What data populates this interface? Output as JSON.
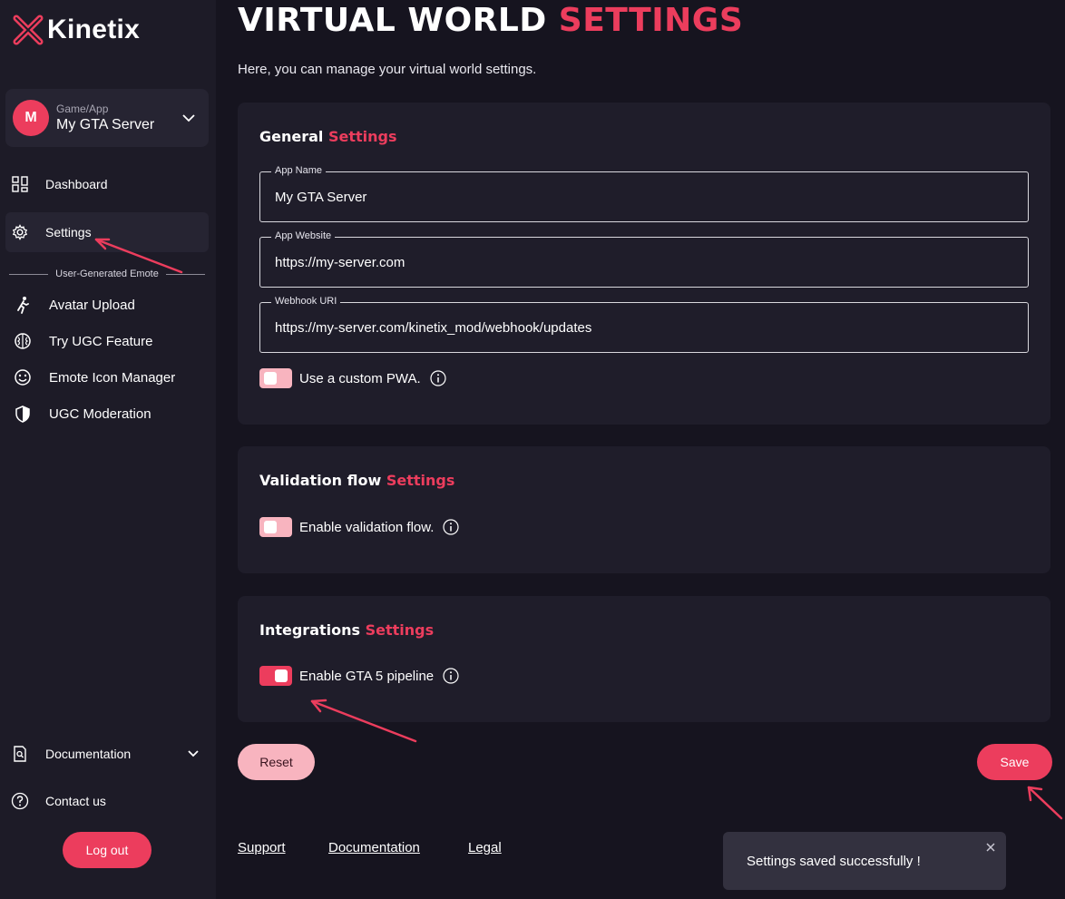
{
  "brand": {
    "name": "Kinetix",
    "accent": "#ec3d5d"
  },
  "sidebar": {
    "app_select": {
      "avatar_letter": "M",
      "caption": "Game/App",
      "name": "My GTA Server"
    },
    "nav": [
      {
        "label": "Dashboard",
        "icon": "dashboard-icon"
      },
      {
        "label": "Settings",
        "icon": "gear-icon",
        "active": true
      }
    ],
    "section_title": "User-Generated Emote",
    "ugc_items": [
      {
        "label": "Avatar Upload",
        "icon": "running-person-icon"
      },
      {
        "label": "Try UGC Feature",
        "icon": "brain-icon"
      },
      {
        "label": "Emote Icon Manager",
        "icon": "smiley-icon"
      },
      {
        "label": "UGC Moderation",
        "icon": "shield-icon"
      }
    ],
    "bottom": [
      {
        "label": "Documentation",
        "icon": "document-search-icon"
      },
      {
        "label": "Contact us",
        "icon": "help-circle-icon"
      }
    ],
    "logout_label": "Log out"
  },
  "header": {
    "title_main": "VIRTUAL WORLD",
    "title_accent": "SETTINGS",
    "subtitle": "Here, you can manage your virtual world settings."
  },
  "general": {
    "title_main": "General",
    "title_accent": "Settings",
    "fields": [
      {
        "label": "App Name",
        "value": "My GTA Server"
      },
      {
        "label": "App Website",
        "value": "https://my-server.com"
      },
      {
        "label": "Webhook URI",
        "value": "https://my-server.com/kinetix_mod/webhook/updates"
      }
    ],
    "toggle_label": "Use a custom PWA.",
    "toggle_on": false
  },
  "validation": {
    "title_main": "Validation flow",
    "title_accent": "Settings",
    "toggle_label": "Enable validation flow.",
    "toggle_on": false
  },
  "integrations": {
    "title_main": "Integrations",
    "title_accent": "Settings",
    "toggle_label": "Enable GTA 5 pipeline",
    "toggle_on": true
  },
  "actions": {
    "reset_label": "Reset",
    "save_label": "Save"
  },
  "footer": {
    "links": [
      "Support",
      "Documentation",
      "Legal"
    ]
  },
  "toast": {
    "message": "Settings saved successfully !"
  }
}
